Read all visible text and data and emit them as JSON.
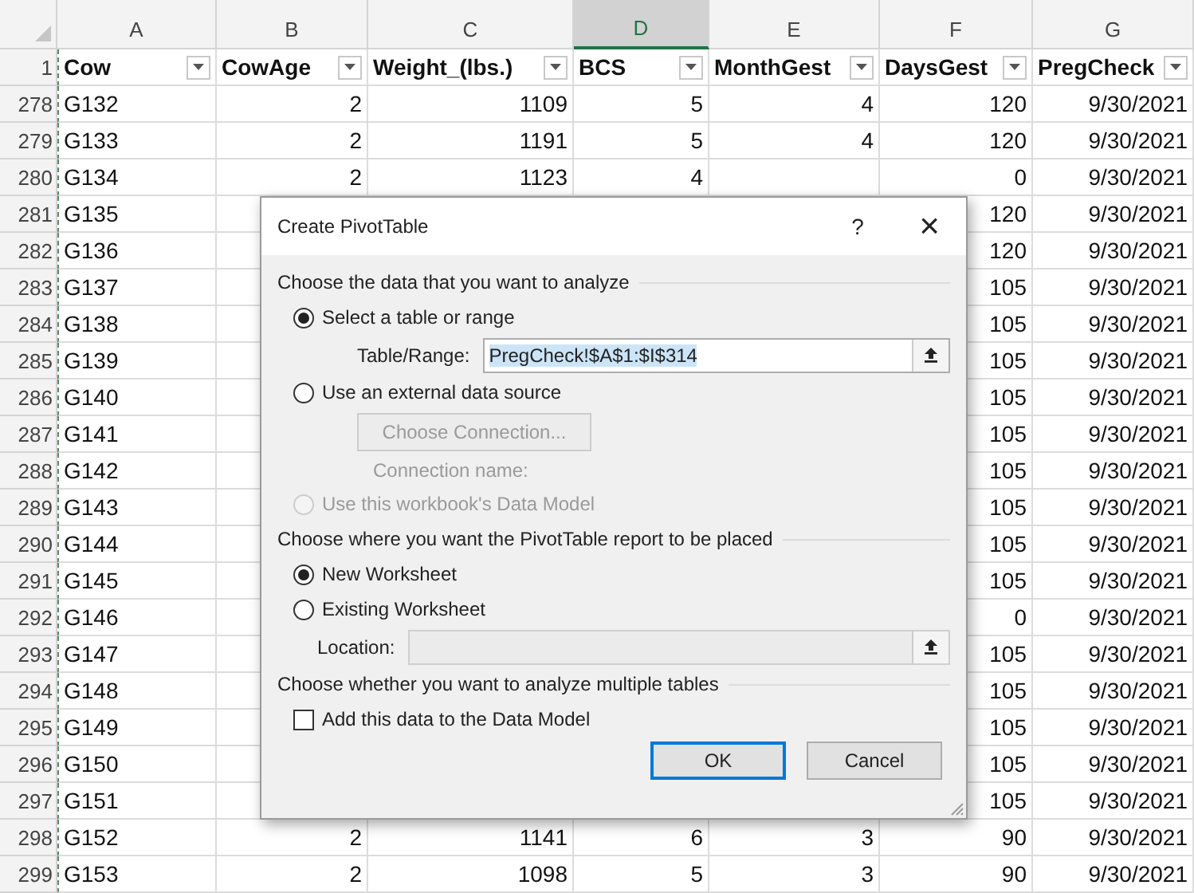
{
  "columns": [
    {
      "letter": "A",
      "selected": false
    },
    {
      "letter": "B",
      "selected": false
    },
    {
      "letter": "C",
      "selected": false
    },
    {
      "letter": "D",
      "selected": true
    },
    {
      "letter": "E",
      "selected": false
    },
    {
      "letter": "F",
      "selected": false
    },
    {
      "letter": "G",
      "selected": false
    }
  ],
  "header_row": {
    "number": "1",
    "cells": [
      "Cow",
      "CowAge",
      "Weight_(lbs.)",
      "BCS",
      "MonthGest",
      "DaysGest",
      "PregCheck"
    ]
  },
  "rows": [
    {
      "number": "278",
      "cells": {
        "A": "G132",
        "B": "2",
        "C": "1109",
        "D": "5",
        "E": "4",
        "F": "120",
        "G": "9/30/2021"
      }
    },
    {
      "number": "279",
      "cells": {
        "A": "G133",
        "B": "2",
        "C": "1191",
        "D": "5",
        "E": "4",
        "F": "120",
        "G": "9/30/2021"
      }
    },
    {
      "number": "280",
      "cells": {
        "A": "G134",
        "B": "2",
        "C": "1123",
        "D": "4",
        "F": "0",
        "G": "9/30/2021"
      }
    },
    {
      "number": "281",
      "cells": {
        "A": "G135",
        "F": "120",
        "G": "9/30/2021"
      }
    },
    {
      "number": "282",
      "cells": {
        "A": "G136",
        "F": "120",
        "G": "9/30/2021"
      }
    },
    {
      "number": "283",
      "cells": {
        "A": "G137",
        "F": "105",
        "G": "9/30/2021"
      }
    },
    {
      "number": "284",
      "cells": {
        "A": "G138",
        "F": "105",
        "G": "9/30/2021"
      }
    },
    {
      "number": "285",
      "cells": {
        "A": "G139",
        "F": "105",
        "G": "9/30/2021"
      }
    },
    {
      "number": "286",
      "cells": {
        "A": "G140",
        "F": "105",
        "G": "9/30/2021"
      }
    },
    {
      "number": "287",
      "cells": {
        "A": "G141",
        "F": "105",
        "G": "9/30/2021"
      }
    },
    {
      "number": "288",
      "cells": {
        "A": "G142",
        "F": "105",
        "G": "9/30/2021"
      }
    },
    {
      "number": "289",
      "cells": {
        "A": "G143",
        "F": "105",
        "G": "9/30/2021"
      }
    },
    {
      "number": "290",
      "cells": {
        "A": "G144",
        "F": "105",
        "G": "9/30/2021"
      }
    },
    {
      "number": "291",
      "cells": {
        "A": "G145",
        "F": "105",
        "G": "9/30/2021"
      }
    },
    {
      "number": "292",
      "cells": {
        "A": "G146",
        "F": "0",
        "G": "9/30/2021"
      }
    },
    {
      "number": "293",
      "cells": {
        "A": "G147",
        "F": "105",
        "G": "9/30/2021"
      }
    },
    {
      "number": "294",
      "cells": {
        "A": "G148",
        "F": "105",
        "G": "9/30/2021"
      }
    },
    {
      "number": "295",
      "cells": {
        "A": "G149",
        "F": "105",
        "G": "9/30/2021"
      }
    },
    {
      "number": "296",
      "cells": {
        "A": "G150",
        "F": "105",
        "G": "9/30/2021"
      }
    },
    {
      "number": "297",
      "cells": {
        "A": "G151",
        "F": "105",
        "G": "9/30/2021"
      }
    },
    {
      "number": "298",
      "cells": {
        "A": "G152",
        "B": "2",
        "C": "1141",
        "D": "6",
        "E": "3",
        "F": "90",
        "G": "9/30/2021"
      }
    },
    {
      "number": "299",
      "cells": {
        "A": "G153",
        "B": "2",
        "C": "1098",
        "D": "5",
        "E": "3",
        "F": "90",
        "G": "9/30/2021"
      }
    }
  ],
  "dialog": {
    "title": "Create PivotTable",
    "help": "?",
    "close": "×",
    "data_heading": "Choose the data that you want to analyze",
    "source_options": [
      {
        "label": "Select a table or range",
        "selected": true,
        "disabled": false
      },
      {
        "label": "Use an external data source",
        "selected": false,
        "disabled": false
      },
      {
        "label": "Use this workbook's Data Model",
        "selected": false,
        "disabled": true
      }
    ],
    "table_range": {
      "label": "Table/Range:",
      "value": "PregCheck!$A$1:$I$314",
      "highlighted": true
    },
    "choose_connection": {
      "label": "Choose Connection...",
      "disabled": true
    },
    "connection_name": "Connection name:",
    "placement_heading": "Choose where you want the PivotTable report to be placed",
    "placement_options": [
      {
        "label": "New Worksheet",
        "selected": true,
        "disabled": false
      },
      {
        "label": "Existing Worksheet",
        "selected": false,
        "disabled": false
      }
    ],
    "location": {
      "label": "Location:",
      "disabled": true
    },
    "multiple_heading": "Choose whether you want to analyze multiple tables",
    "data_model_checkbox": {
      "label": "Add this data to the Data Model",
      "checked": false
    },
    "buttons": [
      {
        "label": "OK",
        "default": true
      },
      {
        "label": "Cancel",
        "default": false
      }
    ]
  }
}
